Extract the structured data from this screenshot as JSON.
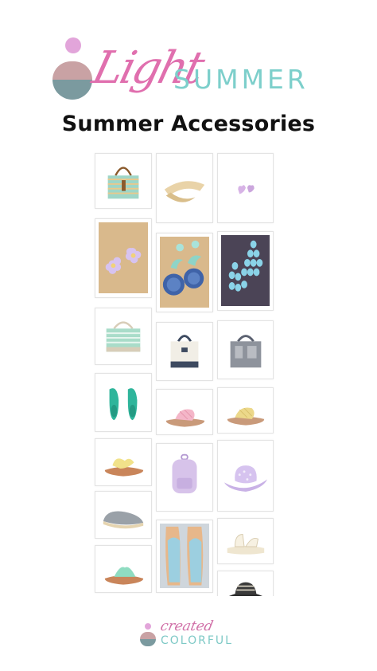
{
  "brand": {
    "script_word": "Light",
    "caps_word": "SUMMER",
    "colors": {
      "pink": "#e06fae",
      "teal": "#7dcfcb",
      "mauve": "#c9a2a4",
      "slate": "#7b9a9f",
      "lilac": "#e2a5da"
    }
  },
  "page_title": "Summer Accessories",
  "products": [
    {
      "name": "striped-tote-bag-icon"
    },
    {
      "name": "straw-visor-icon"
    },
    {
      "name": "heart-stud-earrings-icon"
    },
    {
      "name": "flower-earrings-icon"
    },
    {
      "name": "beaded-disc-earrings-icon"
    },
    {
      "name": "sequin-chandelier-earrings-icon"
    },
    {
      "name": "mint-zip-tote-icon"
    },
    {
      "name": "canvas-boat-tote-icon"
    },
    {
      "name": "gray-canvas-tote-icon"
    },
    {
      "name": "teal-flats-icon"
    },
    {
      "name": "pink-woven-slide-icon"
    },
    {
      "name": "yellow-woven-slide-icon"
    },
    {
      "name": "yellow-knot-sandal-icon"
    },
    {
      "name": "lilac-backpack-icon"
    },
    {
      "name": "lilac-cowboy-hat-icon"
    },
    {
      "name": "gray-espadrille-icon"
    },
    {
      "name": "blue-slogan-espadrille-icon"
    },
    {
      "name": "white-sport-sandal-icon"
    },
    {
      "name": "mint-thong-sandal-icon"
    },
    {
      "name": "striped-sun-hat-icon"
    }
  ],
  "footer": {
    "script_word": "created",
    "caps_word": "COLORFUL"
  }
}
